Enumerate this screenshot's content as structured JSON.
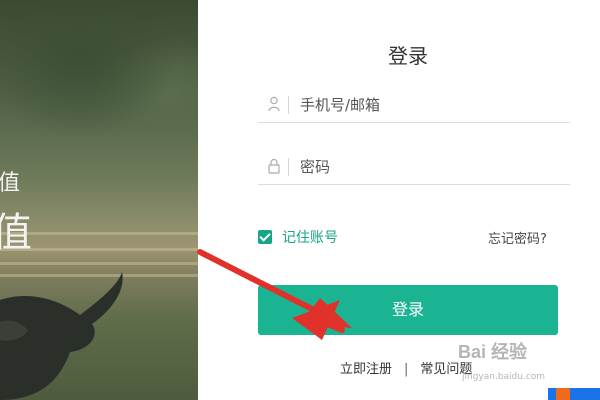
{
  "hero": {
    "text_small": "值",
    "text_large": "值"
  },
  "login": {
    "title": "登录",
    "account_placeholder": "手机号/邮箱",
    "password_placeholder": "密码",
    "remember_label": "记住账号",
    "remember_checked": true,
    "forgot_label": "忘记密码?",
    "submit_label": "登录"
  },
  "footer_links": {
    "register": "立即注册",
    "separator": "|",
    "faq": "常见问题"
  },
  "watermark": {
    "logo": "Bai 经验",
    "url": "jingyan.baidu.com"
  },
  "colors": {
    "accent": "#1bb493",
    "checkbox": "#17a586",
    "arrow": "#e0322b"
  }
}
